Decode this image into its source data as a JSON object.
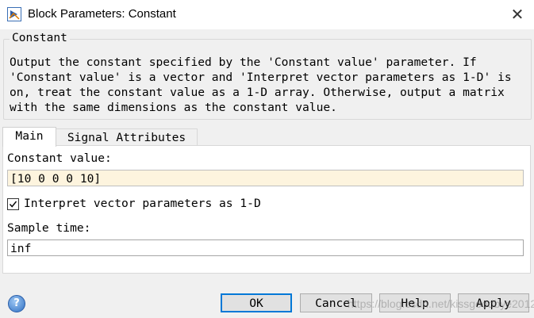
{
  "window": {
    "title": "Block Parameters: Constant",
    "close_glyph": "✕"
  },
  "group": {
    "label": "Constant",
    "description": "Output the constant specified by the 'Constant value' parameter. If\n'Constant value' is a vector and 'Interpret vector parameters as 1-D' is\non, treat the constant value as a 1-D array. Otherwise, output a matrix\nwith the same dimensions as the constant value."
  },
  "tabs": [
    {
      "label": "Main",
      "active": true
    },
    {
      "label": "Signal Attributes",
      "active": false
    }
  ],
  "main": {
    "constant_value_label": "Constant value:",
    "constant_value": "[10 0 0 0 10]",
    "interpret_label": "Interpret vector parameters as 1-D",
    "interpret_checked": true,
    "sample_time_label": "Sample time:",
    "sample_time": "inf"
  },
  "buttons": {
    "ok": "OK",
    "cancel": "Cancel",
    "help": "Help",
    "apply": "Apply"
  },
  "watermark": "https://blog.csdn.net/kissgoodbye2012",
  "icons": {
    "app": "simulink-block-icon",
    "help": "help-icon",
    "close": "close-icon",
    "check": "check-icon"
  }
}
